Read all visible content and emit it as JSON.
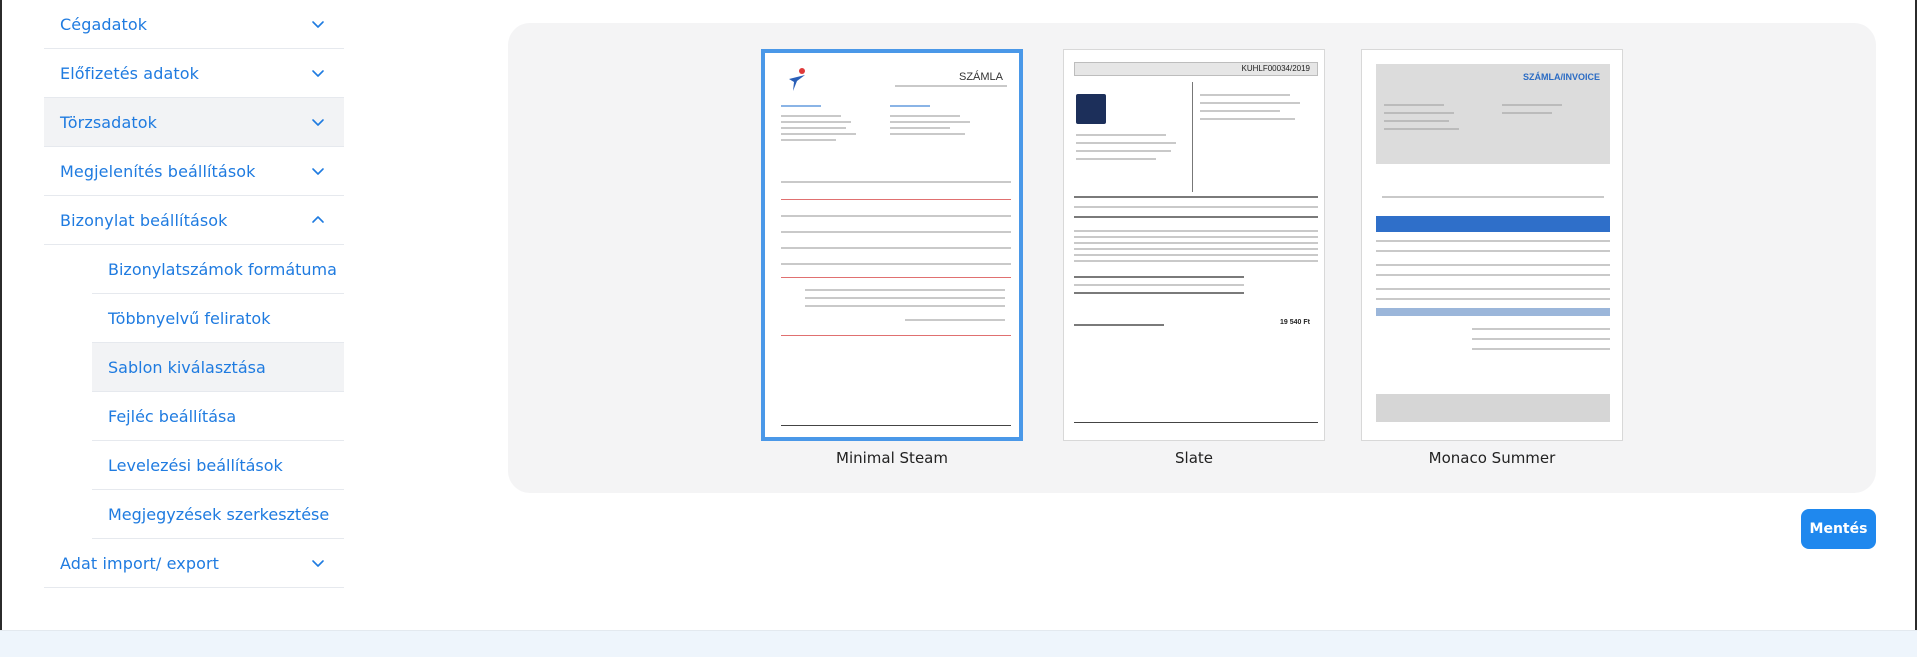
{
  "sidebar": {
    "items": [
      {
        "label": "Cégadatok"
      },
      {
        "label": "Előfizetés adatok"
      },
      {
        "label": "Törzsadatok"
      },
      {
        "label": "Megjelenítés beállítások"
      },
      {
        "label": "Bizonylat beállítások"
      },
      {
        "label": "Adat import/ export"
      }
    ],
    "sub_items": [
      {
        "label": "Bizonylatszámok formátuma"
      },
      {
        "label": "Többnyelvű feliratok"
      },
      {
        "label": "Sablon kiválasztása"
      },
      {
        "label": "Fejléc beállítása"
      },
      {
        "label": "Levelezési beállítások"
      },
      {
        "label": "Megjegyzések szerkesztése"
      }
    ]
  },
  "templates": [
    {
      "name": "Minimal Steam",
      "doc_title": "SZÁMLA",
      "selected": true
    },
    {
      "name": "Slate",
      "doc_number": "KUHLF00034/2019",
      "grand_total": "19 540 Ft"
    },
    {
      "name": "Monaco Summer",
      "doc_title": "SZÁMLA/INVOICE"
    }
  ],
  "save_label": "Mentés",
  "colors": {
    "accent": "#1f7be0",
    "selected_border": "#4a98e8",
    "button": "#1f88ee"
  }
}
